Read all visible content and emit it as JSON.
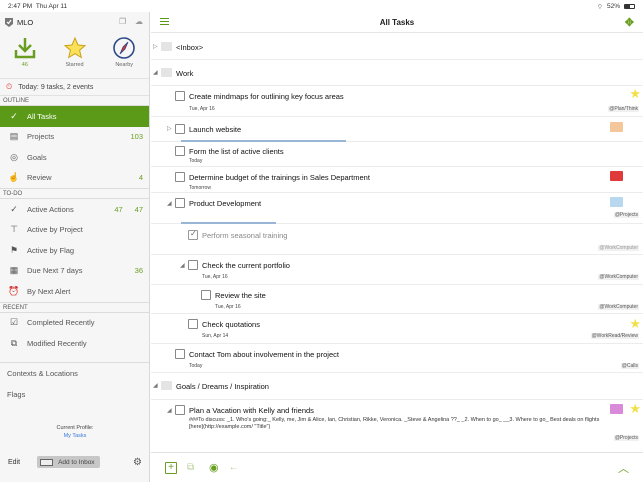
{
  "status": {
    "time": "2:47 PM",
    "date": "Thu Apr 11",
    "battery": "52%"
  },
  "sidebar": {
    "app_name": "MLO",
    "top": [
      {
        "label": "46",
        "icon": "inbox-download-icon"
      },
      {
        "label": "Starred",
        "icon": "star-icon"
      },
      {
        "label": "Nearby",
        "icon": "compass-icon"
      }
    ],
    "today": "Today: 9 tasks, 2 events",
    "outline_label": "OUTLINE",
    "outline": [
      {
        "label": "All Tasks",
        "n1": "",
        "n2": "",
        "icon": "all-tasks-icon"
      },
      {
        "label": "Projects",
        "n1": "",
        "n2": "103",
        "icon": "projects-icon"
      },
      {
        "label": "Goals",
        "n1": "",
        "n2": "",
        "icon": "goals-icon"
      },
      {
        "label": "Review",
        "n1": "",
        "n2": "4",
        "icon": "review-icon"
      }
    ],
    "todo_label": "TO-DO",
    "todo": [
      {
        "label": "Active Actions",
        "n1": "47",
        "n2": "47",
        "icon": "active-actions-icon"
      },
      {
        "label": "Active by Project",
        "n1": "",
        "n2": "",
        "icon": "active-by-project-icon"
      },
      {
        "label": "Active by Flag",
        "n1": "",
        "n2": "",
        "icon": "active-by-flag-icon"
      },
      {
        "label": "Due Next 7 days",
        "n1": "",
        "n2": "36",
        "icon": "due-next-icon"
      },
      {
        "label": "By Next Alert",
        "n1": "",
        "n2": "",
        "icon": "next-alert-icon"
      }
    ],
    "recent_label": "RECENT",
    "recent": [
      {
        "label": "Completed Recently",
        "icon": "completed-recently-icon"
      },
      {
        "label": "Modified Recently",
        "icon": "modified-recently-icon"
      }
    ],
    "contexts": "Contexts & Locations",
    "flags": "Flags",
    "profile_label": "Current Profile:",
    "profile_name": "My Tasks",
    "edit": "Edit",
    "add_inbox": "Add to Inbox"
  },
  "main": {
    "title": "All Tasks",
    "rows": [
      {
        "type": "folder",
        "title": "<Inbox>"
      },
      {
        "type": "folder",
        "title": "Work"
      },
      {
        "title": "Create mindmaps for outlining key focus areas",
        "sub": "Tue, Apr 16",
        "ctx": "@Plan/Think",
        "star": "#f2e04a"
      },
      {
        "title": "Launch website",
        "flag": "#f3c79a"
      },
      {
        "title": "Form the list of active clients",
        "sub": "Today"
      },
      {
        "title": "Determine budget of the trainings in Sales Department",
        "sub": "Tomorrow",
        "flag": "#e03a3a"
      },
      {
        "title": "Product Development",
        "ctx": "@Projects",
        "flag": "#b7d8ef"
      },
      {
        "title": "Perform seasonal training",
        "ctx": "@WorkComputer",
        "done": true
      },
      {
        "title": "Check the current portfolio",
        "sub": "Tue, Apr 16",
        "ctx": "@WorkComputer"
      },
      {
        "title": "Review the site",
        "sub": "Tue, Apr 16",
        "ctx": "@WorkComputer"
      },
      {
        "title": "Check quotations",
        "sub": "Sun, Apr 14",
        "ctx": "@WorkRead/Review",
        "star": "#f2e04a"
      },
      {
        "title": "Contact Tom about involvement in the project",
        "sub": "Today",
        "ctx": "@Calls"
      },
      {
        "type": "folder",
        "title": "Goals / Dreams / Inspiration"
      },
      {
        "title": "Plan a Vacation with Kelly and friends",
        "note": "###To discuss: _1. Who's going:_ Kelly, me, Jim & Alice, Ian, Christian, Rikke, Veronica. _Steve & Angelina ??_ _2. When to go_ __3. Where to go_ Best deals on flights [here](http://example.com/ \"Title\")",
        "ctx": "@Projects",
        "flag": "#d98ad8",
        "star": "#f2e04a"
      }
    ]
  }
}
